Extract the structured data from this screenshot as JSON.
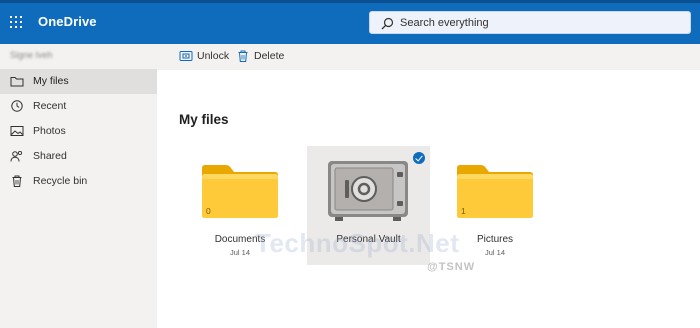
{
  "app": {
    "title": "OneDrive",
    "brand_color": "#0f6cbd"
  },
  "search": {
    "placeholder": "Search everything"
  },
  "account": {
    "name": "Signe Iveh"
  },
  "sidebar": {
    "items": [
      {
        "label": "My files",
        "icon": "folder-icon",
        "active": true
      },
      {
        "label": "Recent",
        "icon": "recent-icon"
      },
      {
        "label": "Photos",
        "icon": "photos-icon"
      },
      {
        "label": "Shared",
        "icon": "shared-icon"
      },
      {
        "label": "Recycle bin",
        "icon": "recycle-bin-icon"
      }
    ]
  },
  "toolbar": {
    "unlock_label": "Unlock",
    "delete_label": "Delete"
  },
  "main": {
    "title": "My files",
    "items": [
      {
        "name": "Documents",
        "date": "Jul 14",
        "count": "0",
        "type": "folder"
      },
      {
        "name": "Personal Vault",
        "type": "vault",
        "selected": true
      },
      {
        "name": "Pictures",
        "date": "Jul 14",
        "count": "1",
        "type": "folder"
      }
    ]
  },
  "watermark": {
    "text": "TechnoSpot.Net",
    "handle": "@TSNW"
  }
}
